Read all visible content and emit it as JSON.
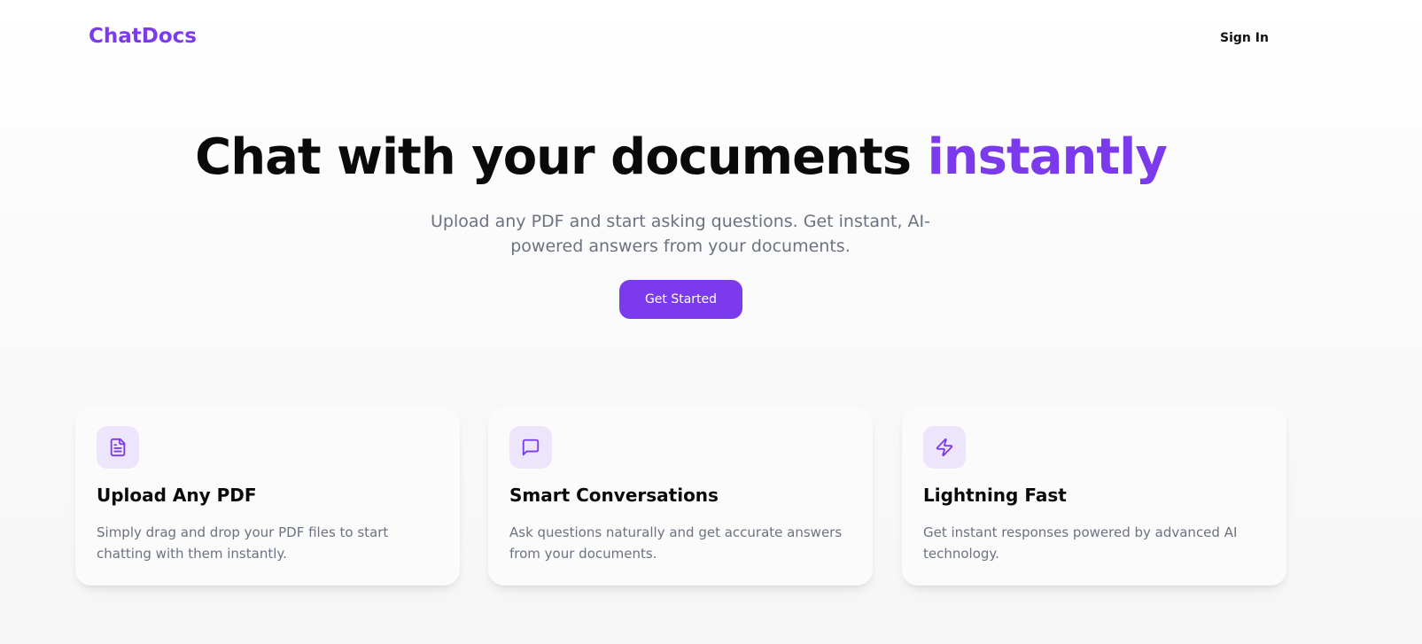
{
  "header": {
    "brand": "ChatDocs",
    "signin_label": "Sign In"
  },
  "hero": {
    "title_main": "Chat with your documents",
    "title_accent": "instantly",
    "subtitle": "Upload any PDF and start asking questions. Get instant, AI-powered answers from your documents.",
    "cta_label": "Get Started"
  },
  "features": [
    {
      "icon": "file-text-icon",
      "title": "Upload Any PDF",
      "description": "Simply drag and drop your PDF files to start chatting with them instantly."
    },
    {
      "icon": "message-square-icon",
      "title": "Smart Conversations",
      "description": "Ask questions naturally and get accurate answers from your documents."
    },
    {
      "icon": "zap-icon",
      "title": "Lightning Fast",
      "description": "Get instant responses powered by advanced AI technology."
    }
  ],
  "colors": {
    "accent": "#7c3aed",
    "icon_bg": "#ede5fc",
    "muted_text": "#6b7280"
  }
}
